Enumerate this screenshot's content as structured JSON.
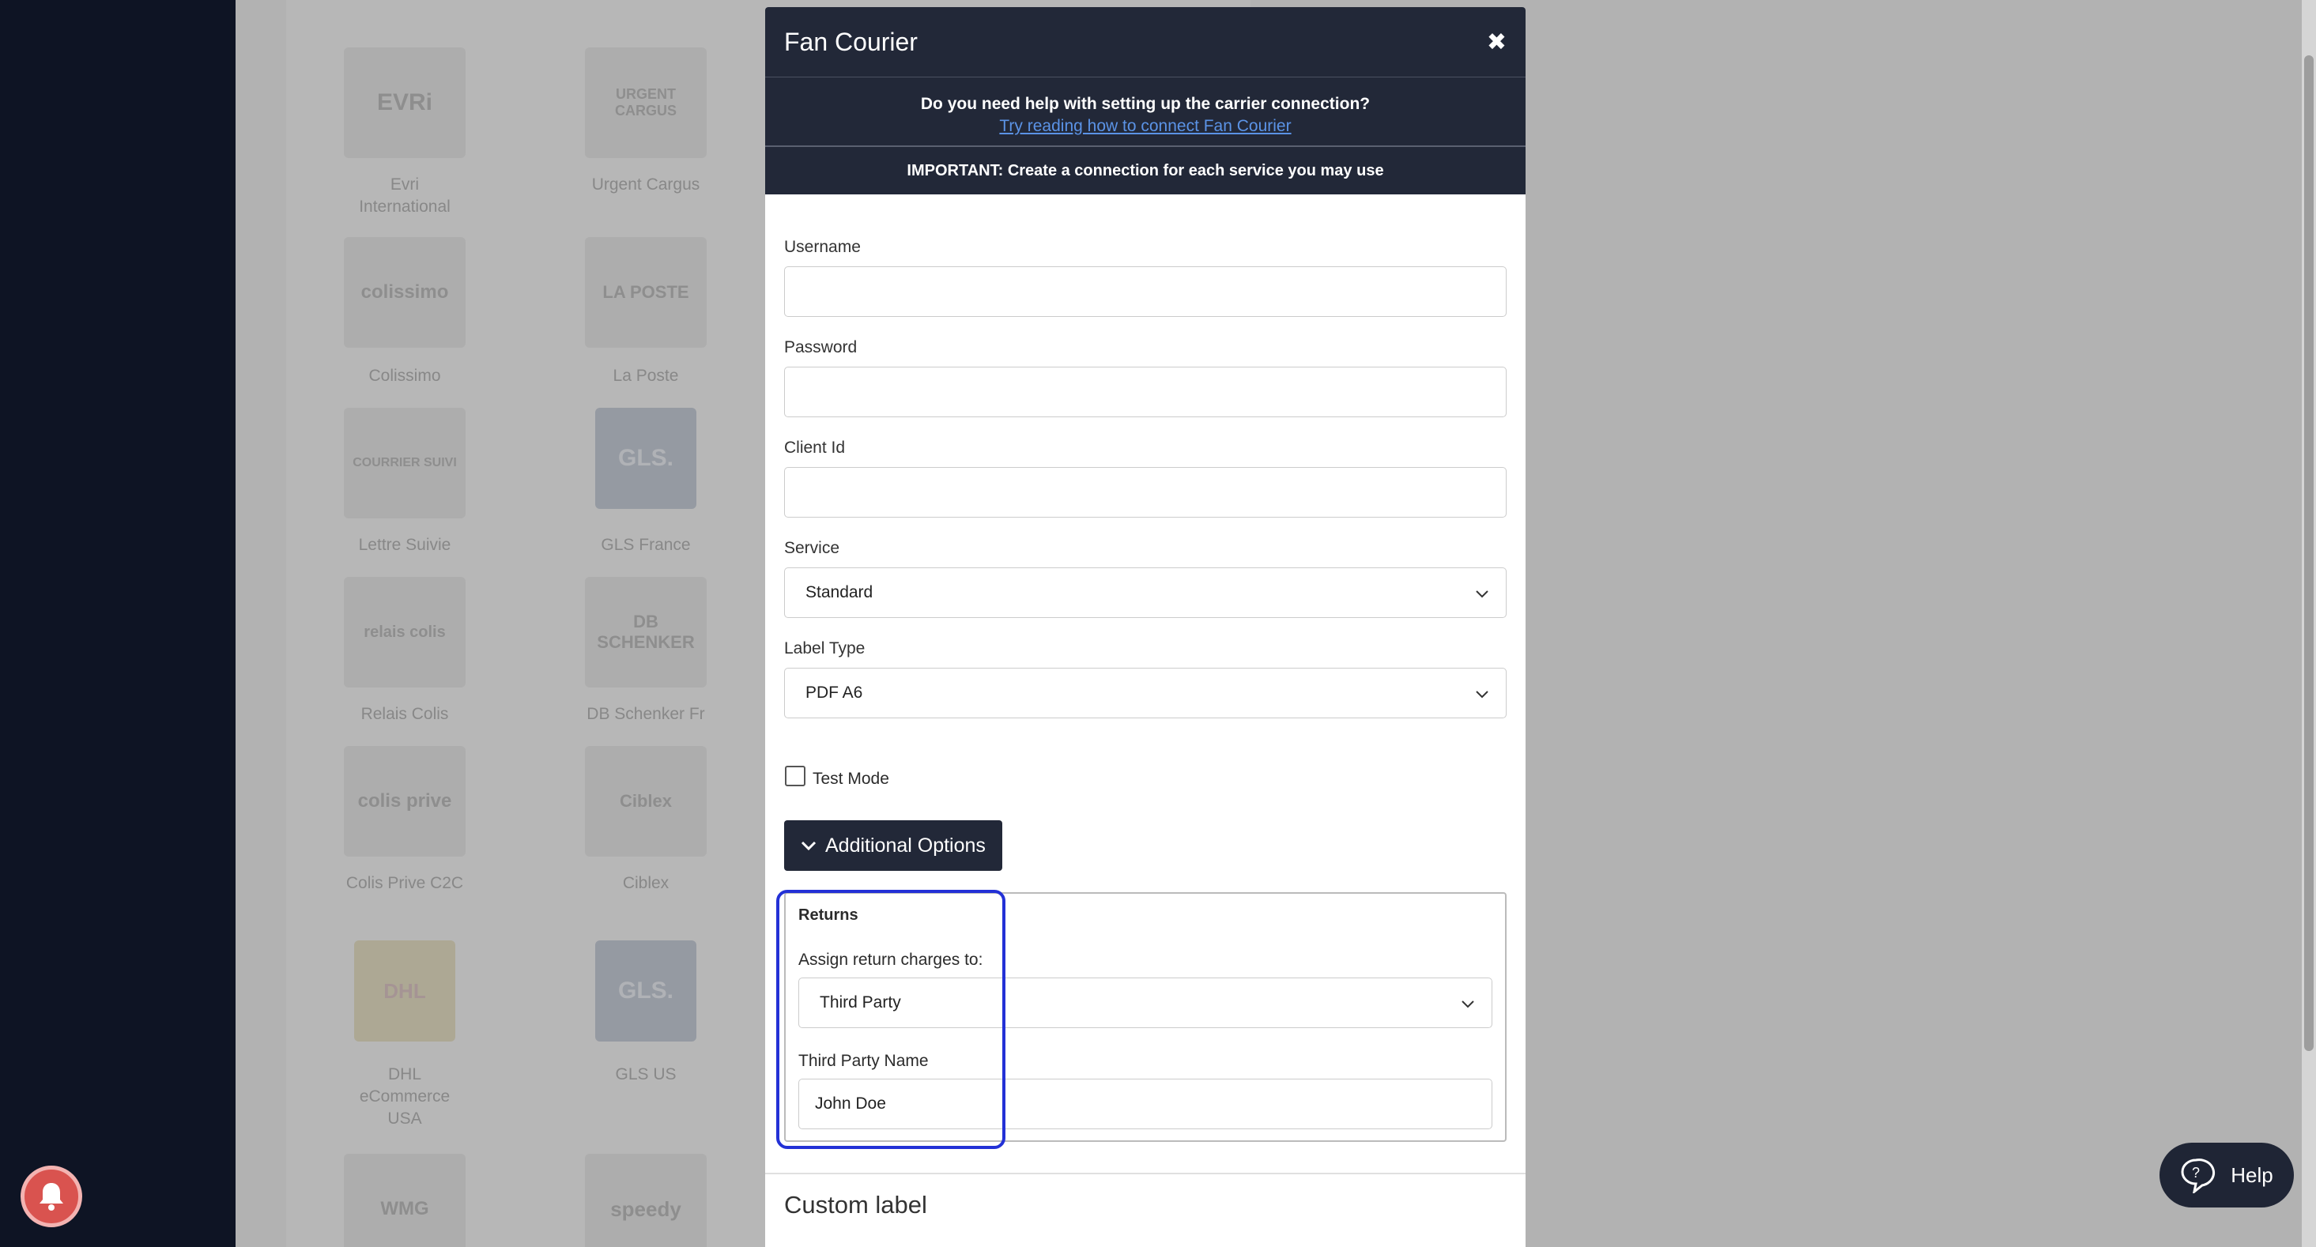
{
  "background": {
    "carriers": [
      {
        "name_lines": [
          "Evri",
          "International"
        ],
        "logo": "EVRi"
      },
      {
        "name_lines": [
          "Urgent Cargus"
        ],
        "logo": "URGENT CARGUS"
      },
      {
        "name_lines": [
          "Colissimo"
        ],
        "logo": "colissimo"
      },
      {
        "name_lines": [
          "La Poste"
        ],
        "logo": "LA POSTE"
      },
      {
        "name_lines": [
          "Lettre Suivie"
        ],
        "logo": "COURRIER SUIVI"
      },
      {
        "name_lines": [
          "GLS France"
        ],
        "logo": "GLS."
      },
      {
        "name_lines": [
          "Relais Colis"
        ],
        "logo": "relais colis"
      },
      {
        "name_lines": [
          "DB Schenker Fr"
        ],
        "logo": "DB SCHENKER"
      },
      {
        "name_lines": [
          "Colis Prive C2C"
        ],
        "logo": "colis prive"
      },
      {
        "name_lines": [
          "Ciblex"
        ],
        "logo": "Ciblex"
      },
      {
        "name_lines": [
          "DHL",
          "eCommerce",
          "USA"
        ],
        "logo": "DHL"
      },
      {
        "name_lines": [
          "GLS US"
        ],
        "logo": "GLS."
      },
      {
        "name_lines": [
          ""
        ],
        "logo": "WMG"
      },
      {
        "name_lines": [
          ""
        ],
        "logo": "speedy"
      }
    ]
  },
  "modal": {
    "title": "Fan Courier",
    "help_question": "Do you need help with setting up the carrier connection?",
    "help_link": "Try reading how to connect Fan Courier",
    "important": "IMPORTANT: Create a connection for each service you may use",
    "fields": {
      "username": {
        "label": "Username",
        "value": ""
      },
      "password": {
        "label": "Password",
        "value": ""
      },
      "client_id": {
        "label": "Client Id",
        "value": ""
      },
      "service": {
        "label": "Service",
        "value": "Standard"
      },
      "label_type": {
        "label": "Label Type",
        "value": "PDF A6"
      }
    },
    "test_mode": {
      "label": "Test Mode",
      "checked": false
    },
    "additional_options_label": "Additional Options",
    "returns": {
      "heading": "Returns",
      "assign_label": "Assign return charges to:",
      "assign_value": "Third Party",
      "third_party_label": "Third Party Name",
      "third_party_value": "John Doe"
    },
    "custom_label_heading": "Custom label"
  },
  "help_widget": {
    "label": "Help"
  },
  "colors": {
    "dark": "#222838",
    "highlight": "#2331d6",
    "link": "#5b93e6"
  }
}
